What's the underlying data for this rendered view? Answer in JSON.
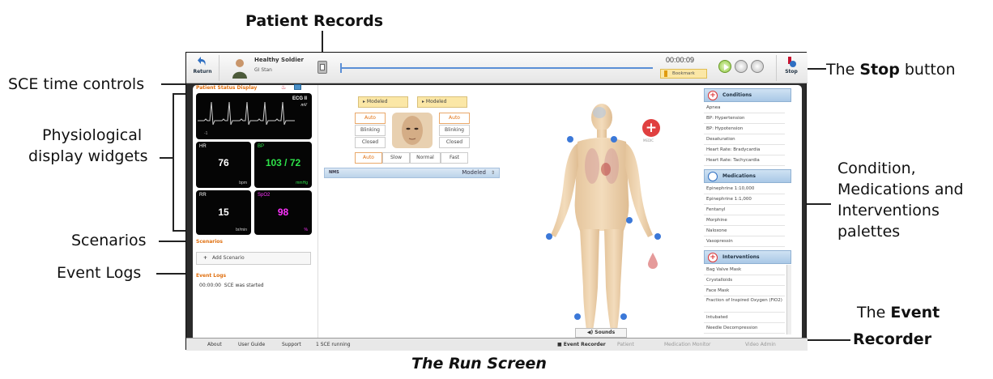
{
  "callouts": {
    "patient_records": "Patient Records",
    "sce_time_controls": "SCE time controls",
    "physiological_1": "Physiological",
    "physiological_2": "display widgets",
    "scenarios": "Scenarios",
    "event_logs": "Event Logs",
    "stop_prefix": "The ",
    "stop_bold": "Stop",
    "stop_suffix": " button",
    "palettes_1": "Condition,",
    "palettes_2": "Medications and",
    "palettes_3": "Interventions",
    "palettes_4": "palettes",
    "event_recorder_prefix": "The ",
    "event_recorder_bold1": "Event",
    "event_recorder_bold2": "Recorder",
    "caption": "The Run Screen"
  },
  "topbar": {
    "return_label": "Return",
    "patient_name": "Healthy Soldier",
    "patient_sub": "GI Stan",
    "timer": "00:00:09",
    "bookmark_label": "Bookmark",
    "stop_label": "Stop"
  },
  "patient_status": {
    "title": "Patient Status Display",
    "ecg_label": "ECG II",
    "ecg_unit": "mV",
    "ecg_scale": "-1",
    "hr_label": "HR",
    "hr_value": "76",
    "hr_unit": "bpm",
    "bp_label": "BP",
    "bp_value": "103 / 72",
    "bp_unit": "mmHg",
    "rr_label": "RR",
    "rr_value": "15",
    "rr_unit": "br/min",
    "spo2_label": "SpO2",
    "spo2_value": "98",
    "spo2_unit": "%"
  },
  "scenarios": {
    "title": "Scenarios",
    "add_label": "Add Scenario"
  },
  "event_logs": {
    "title": "Event Logs",
    "entries": [
      {
        "time": "00:00:00",
        "text": "SCE was started"
      }
    ]
  },
  "face_controls": {
    "left_modeled": "Modeled",
    "right_modeled": "Modeled",
    "auto": "Auto",
    "blinking": "Blinking",
    "closed": "Closed",
    "speed": [
      "Auto",
      "Slow",
      "Normal",
      "Fast"
    ],
    "nms_label": "NMS",
    "nms_value": "Modeled"
  },
  "body": {
    "medic_label": "MEDIC",
    "sounds_label": "Sounds"
  },
  "conditions": {
    "title": "Conditions",
    "items": [
      "Apnea",
      "BP: Hypertension",
      "BP: Hypotension",
      "Desaturation",
      "Heart Rate: Bradycardia",
      "Heart Rate: Tachycardia"
    ]
  },
  "medications": {
    "title": "Medications",
    "items": [
      "Epinephrine 1:10,000",
      "Epinephrine 1:1,000",
      "Fentanyl",
      "Morphine",
      "Naloxone",
      "Vasopressin"
    ]
  },
  "interventions": {
    "title": "Interventions",
    "items": [
      "Bag Valve Mask",
      "Crystalloids",
      "Face Mask",
      "Fraction of Inspired Oxygen (FiO2)",
      "Intubated",
      "Needle Decompression"
    ]
  },
  "footer": {
    "about": "About",
    "user_guide": "User Guide",
    "support": "Support",
    "status": "1 SCE running",
    "event_recorder": "Event Recorder",
    "patient": "Patient",
    "medication_monitor": "Medication Monitor",
    "video_admin": "Video Admin"
  },
  "colors": {
    "accent_orange": "#e07010",
    "bp_green": "#2ee34a",
    "spo2_magenta": "#ff33ff",
    "palette_blue": "#a9c8e6",
    "scrubber_blue": "#5b8fd6"
  }
}
